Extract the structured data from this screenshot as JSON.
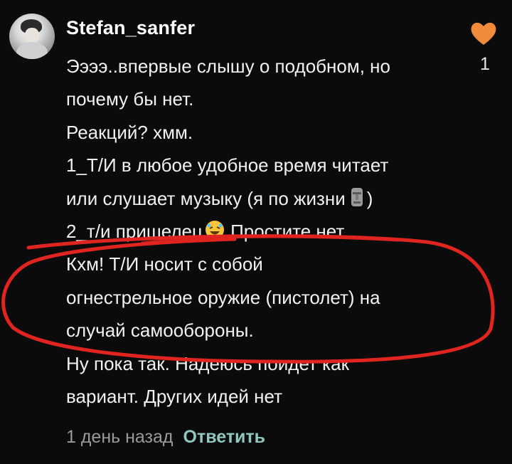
{
  "comment": {
    "username": "Stefan_sanfer",
    "likes": "1",
    "lines": [
      "Ээээ..впервые слышу о подобном, но",
      "почему бы нет.",
      "Реакций? хмм.",
      "1_Т/И  в любое удобное время читает",
      "или слушает музыку (я по жизни",
      ")",
      "2_т/и пришелец",
      " Простите нет",
      "Кхм! Т/И носит с собой",
      "огнестрельное оружие (пистолет) на",
      "случай самообороны.",
      "Ну пока так. Надеюсь поидет как",
      "вариант. Других идей нет"
    ],
    "timestamp": "1 день назад",
    "reply_label": "Ответить"
  },
  "icons": {
    "heart": "heart-icon",
    "moai": "moai-emoji-icon",
    "rofl": "rofl-emoji-icon"
  },
  "colors": {
    "background": "#0b0b0b",
    "heart": "#f28a3c",
    "reply": "#8fc8c0",
    "timestamp": "#9a9a9a",
    "annotation": "#e0241f"
  }
}
